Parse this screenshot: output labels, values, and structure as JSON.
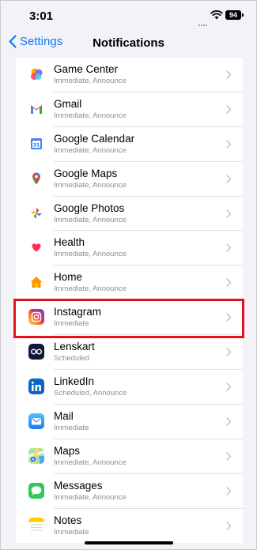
{
  "status": {
    "time": "3:01",
    "battery": "94"
  },
  "nav": {
    "back_label": "Settings",
    "title": "Notifications"
  },
  "apps": [
    {
      "name": "Game Center",
      "sub": "Immediate, Announce",
      "icon": "game-center-icon"
    },
    {
      "name": "Gmail",
      "sub": "Immediate, Announce",
      "icon": "gmail-icon"
    },
    {
      "name": "Google Calendar",
      "sub": "Immediate, Announce",
      "icon": "google-calendar-icon"
    },
    {
      "name": "Google Maps",
      "sub": "Immediate, Announce",
      "icon": "google-maps-icon"
    },
    {
      "name": "Google Photos",
      "sub": "Immediate, Announce",
      "icon": "google-photos-icon"
    },
    {
      "name": "Health",
      "sub": "Immediate, Announce",
      "icon": "health-icon"
    },
    {
      "name": "Home",
      "sub": "Immediate, Announce",
      "icon": "home-icon"
    },
    {
      "name": "Instagram",
      "sub": "Immediate",
      "icon": "instagram-icon"
    },
    {
      "name": "Lenskart",
      "sub": "Scheduled",
      "icon": "lenskart-icon"
    },
    {
      "name": "LinkedIn",
      "sub": "Scheduled, Announce",
      "icon": "linkedin-icon"
    },
    {
      "name": "Mail",
      "sub": "Immediate",
      "icon": "mail-icon"
    },
    {
      "name": "Maps",
      "sub": "Immediate, Announce",
      "icon": "maps-icon"
    },
    {
      "name": "Messages",
      "sub": "Immediate, Announce",
      "icon": "messages-icon"
    },
    {
      "name": "Notes",
      "sub": "Immediate",
      "icon": "notes-icon"
    }
  ],
  "highlighted_app": "Instagram",
  "colors": {
    "accent": "#0a7aff",
    "highlight": "#e0151b"
  }
}
